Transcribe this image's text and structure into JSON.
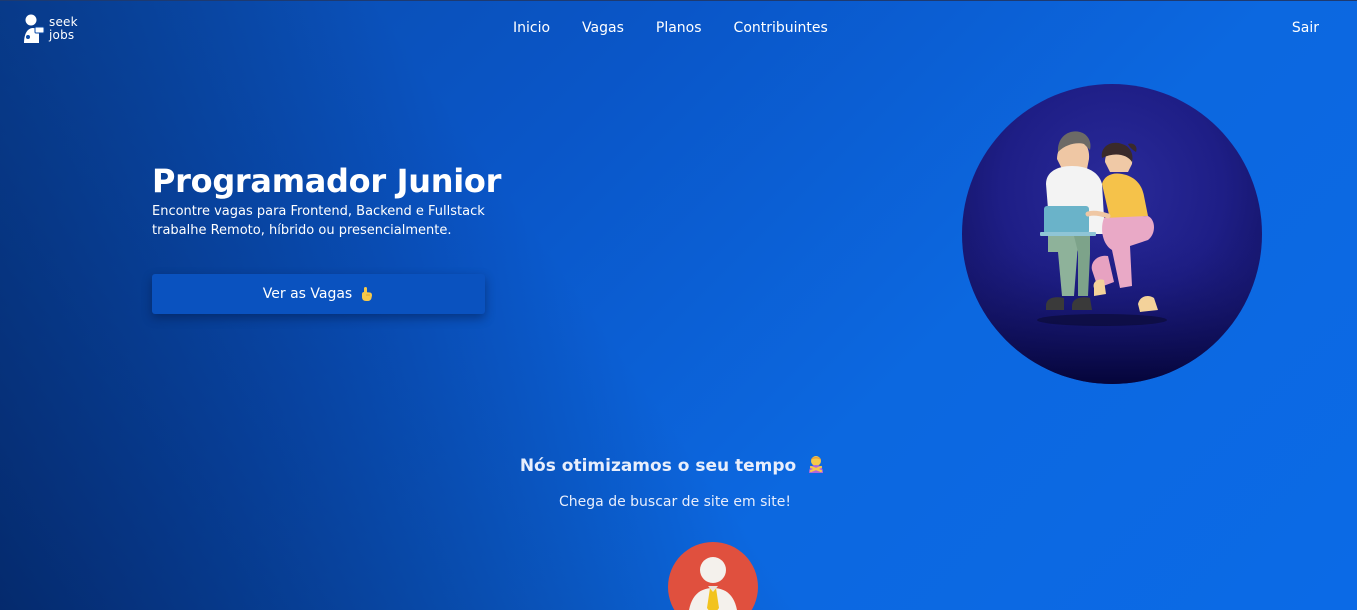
{
  "brand": {
    "line1": "seek",
    "line2": "jobs"
  },
  "nav": {
    "links": [
      {
        "label": "Inicio"
      },
      {
        "label": "Vagas"
      },
      {
        "label": "Planos"
      },
      {
        "label": "Contribuintes"
      }
    ],
    "exit_label": "Sair"
  },
  "hero": {
    "title": "Programador Junior",
    "subtitle_line1": "Encontre vagas para Frontend, Backend e Fullstack",
    "subtitle_line2": "trabalhe Remoto, híbrido ou presencialmente.",
    "cta_label": "Ver as Vagas",
    "cta_icon": "pointing-hand-icon"
  },
  "section": {
    "title": "Nós otimizamos o seu tempo",
    "title_icon": "person-gesturing-no-icon",
    "subtitle": "Chega de buscar de site em site!"
  },
  "colors": {
    "primary": "#0a56c8",
    "button": "#0a52bf",
    "circle": "#1e1e86",
    "avatar_bg": "#e0503e"
  }
}
